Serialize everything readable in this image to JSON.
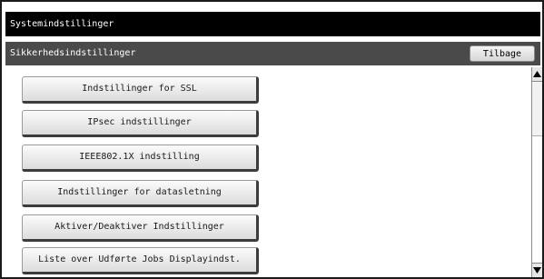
{
  "window": {
    "title": "Systemindstillinger"
  },
  "header": {
    "section_title": "Sikkerhedsindstillinger",
    "back_label": "Tilbage"
  },
  "menu": {
    "items": [
      {
        "label": "Indstillinger for SSL"
      },
      {
        "label": "IPsec indstillinger"
      },
      {
        "label": "IEEE802.1X indstilling"
      },
      {
        "label": "Indstillinger for datasletning"
      },
      {
        "label": "Aktiver/Deaktiver Indstillinger"
      },
      {
        "label": "Liste over Udførte Jobs Displayindst."
      }
    ]
  },
  "scroll": {
    "up_icon": "triangle-up-icon",
    "down_icon": "triangle-down-icon",
    "position": 0
  },
  "colors": {
    "title_bar": "#000000",
    "sub_bar": "#4a4a4a",
    "button_face": "#e8e8e8"
  }
}
